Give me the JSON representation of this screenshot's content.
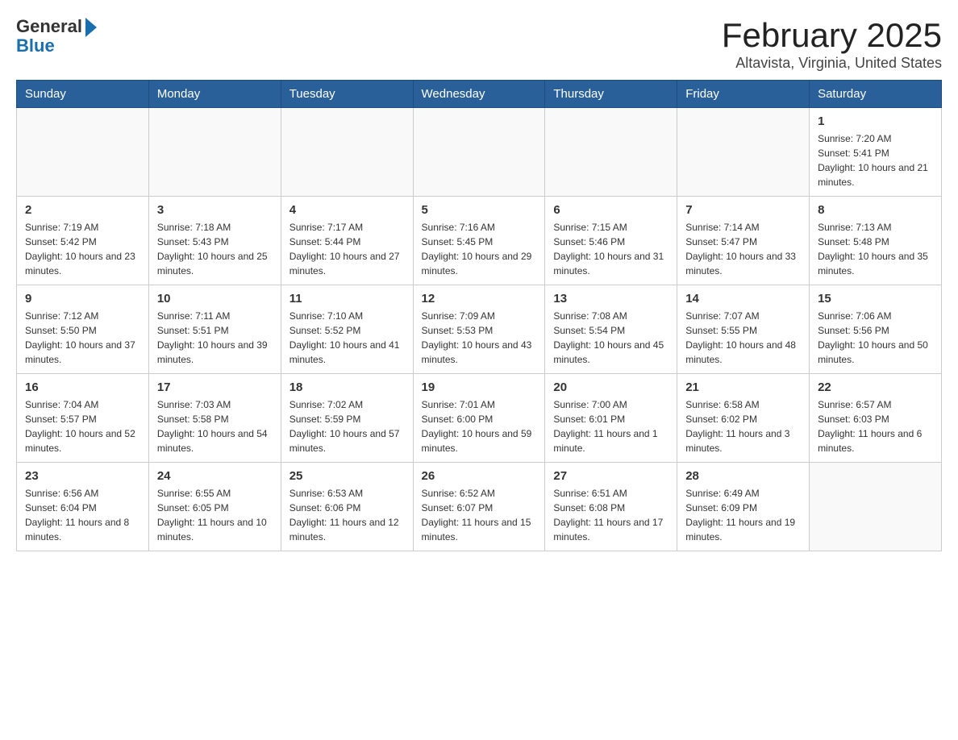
{
  "logo": {
    "general": "General",
    "blue": "Blue"
  },
  "header": {
    "month": "February 2025",
    "location": "Altavista, Virginia, United States"
  },
  "weekdays": [
    "Sunday",
    "Monday",
    "Tuesday",
    "Wednesday",
    "Thursday",
    "Friday",
    "Saturday"
  ],
  "weeks": [
    [
      {
        "day": "",
        "sunrise": "",
        "sunset": "",
        "daylight": ""
      },
      {
        "day": "",
        "sunrise": "",
        "sunset": "",
        "daylight": ""
      },
      {
        "day": "",
        "sunrise": "",
        "sunset": "",
        "daylight": ""
      },
      {
        "day": "",
        "sunrise": "",
        "sunset": "",
        "daylight": ""
      },
      {
        "day": "",
        "sunrise": "",
        "sunset": "",
        "daylight": ""
      },
      {
        "day": "",
        "sunrise": "",
        "sunset": "",
        "daylight": ""
      },
      {
        "day": "1",
        "sunrise": "Sunrise: 7:20 AM",
        "sunset": "Sunset: 5:41 PM",
        "daylight": "Daylight: 10 hours and 21 minutes."
      }
    ],
    [
      {
        "day": "2",
        "sunrise": "Sunrise: 7:19 AM",
        "sunset": "Sunset: 5:42 PM",
        "daylight": "Daylight: 10 hours and 23 minutes."
      },
      {
        "day": "3",
        "sunrise": "Sunrise: 7:18 AM",
        "sunset": "Sunset: 5:43 PM",
        "daylight": "Daylight: 10 hours and 25 minutes."
      },
      {
        "day": "4",
        "sunrise": "Sunrise: 7:17 AM",
        "sunset": "Sunset: 5:44 PM",
        "daylight": "Daylight: 10 hours and 27 minutes."
      },
      {
        "day": "5",
        "sunrise": "Sunrise: 7:16 AM",
        "sunset": "Sunset: 5:45 PM",
        "daylight": "Daylight: 10 hours and 29 minutes."
      },
      {
        "day": "6",
        "sunrise": "Sunrise: 7:15 AM",
        "sunset": "Sunset: 5:46 PM",
        "daylight": "Daylight: 10 hours and 31 minutes."
      },
      {
        "day": "7",
        "sunrise": "Sunrise: 7:14 AM",
        "sunset": "Sunset: 5:47 PM",
        "daylight": "Daylight: 10 hours and 33 minutes."
      },
      {
        "day": "8",
        "sunrise": "Sunrise: 7:13 AM",
        "sunset": "Sunset: 5:48 PM",
        "daylight": "Daylight: 10 hours and 35 minutes."
      }
    ],
    [
      {
        "day": "9",
        "sunrise": "Sunrise: 7:12 AM",
        "sunset": "Sunset: 5:50 PM",
        "daylight": "Daylight: 10 hours and 37 minutes."
      },
      {
        "day": "10",
        "sunrise": "Sunrise: 7:11 AM",
        "sunset": "Sunset: 5:51 PM",
        "daylight": "Daylight: 10 hours and 39 minutes."
      },
      {
        "day": "11",
        "sunrise": "Sunrise: 7:10 AM",
        "sunset": "Sunset: 5:52 PM",
        "daylight": "Daylight: 10 hours and 41 minutes."
      },
      {
        "day": "12",
        "sunrise": "Sunrise: 7:09 AM",
        "sunset": "Sunset: 5:53 PM",
        "daylight": "Daylight: 10 hours and 43 minutes."
      },
      {
        "day": "13",
        "sunrise": "Sunrise: 7:08 AM",
        "sunset": "Sunset: 5:54 PM",
        "daylight": "Daylight: 10 hours and 45 minutes."
      },
      {
        "day": "14",
        "sunrise": "Sunrise: 7:07 AM",
        "sunset": "Sunset: 5:55 PM",
        "daylight": "Daylight: 10 hours and 48 minutes."
      },
      {
        "day": "15",
        "sunrise": "Sunrise: 7:06 AM",
        "sunset": "Sunset: 5:56 PM",
        "daylight": "Daylight: 10 hours and 50 minutes."
      }
    ],
    [
      {
        "day": "16",
        "sunrise": "Sunrise: 7:04 AM",
        "sunset": "Sunset: 5:57 PM",
        "daylight": "Daylight: 10 hours and 52 minutes."
      },
      {
        "day": "17",
        "sunrise": "Sunrise: 7:03 AM",
        "sunset": "Sunset: 5:58 PM",
        "daylight": "Daylight: 10 hours and 54 minutes."
      },
      {
        "day": "18",
        "sunrise": "Sunrise: 7:02 AM",
        "sunset": "Sunset: 5:59 PM",
        "daylight": "Daylight: 10 hours and 57 minutes."
      },
      {
        "day": "19",
        "sunrise": "Sunrise: 7:01 AM",
        "sunset": "Sunset: 6:00 PM",
        "daylight": "Daylight: 10 hours and 59 minutes."
      },
      {
        "day": "20",
        "sunrise": "Sunrise: 7:00 AM",
        "sunset": "Sunset: 6:01 PM",
        "daylight": "Daylight: 11 hours and 1 minute."
      },
      {
        "day": "21",
        "sunrise": "Sunrise: 6:58 AM",
        "sunset": "Sunset: 6:02 PM",
        "daylight": "Daylight: 11 hours and 3 minutes."
      },
      {
        "day": "22",
        "sunrise": "Sunrise: 6:57 AM",
        "sunset": "Sunset: 6:03 PM",
        "daylight": "Daylight: 11 hours and 6 minutes."
      }
    ],
    [
      {
        "day": "23",
        "sunrise": "Sunrise: 6:56 AM",
        "sunset": "Sunset: 6:04 PM",
        "daylight": "Daylight: 11 hours and 8 minutes."
      },
      {
        "day": "24",
        "sunrise": "Sunrise: 6:55 AM",
        "sunset": "Sunset: 6:05 PM",
        "daylight": "Daylight: 11 hours and 10 minutes."
      },
      {
        "day": "25",
        "sunrise": "Sunrise: 6:53 AM",
        "sunset": "Sunset: 6:06 PM",
        "daylight": "Daylight: 11 hours and 12 minutes."
      },
      {
        "day": "26",
        "sunrise": "Sunrise: 6:52 AM",
        "sunset": "Sunset: 6:07 PM",
        "daylight": "Daylight: 11 hours and 15 minutes."
      },
      {
        "day": "27",
        "sunrise": "Sunrise: 6:51 AM",
        "sunset": "Sunset: 6:08 PM",
        "daylight": "Daylight: 11 hours and 17 minutes."
      },
      {
        "day": "28",
        "sunrise": "Sunrise: 6:49 AM",
        "sunset": "Sunset: 6:09 PM",
        "daylight": "Daylight: 11 hours and 19 minutes."
      },
      {
        "day": "",
        "sunrise": "",
        "sunset": "",
        "daylight": ""
      }
    ]
  ]
}
